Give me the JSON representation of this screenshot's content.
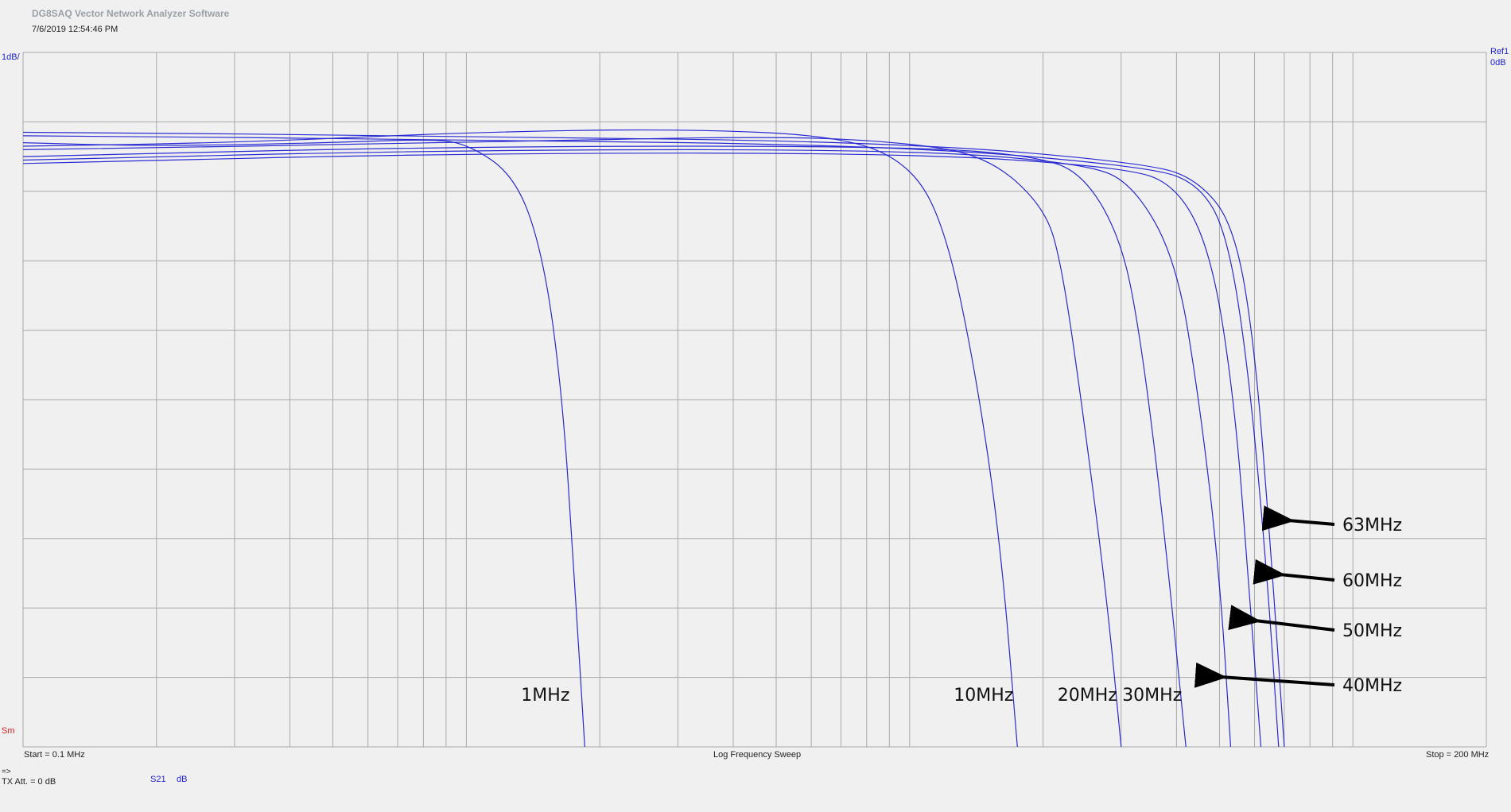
{
  "app": {
    "title": "DG8SAQ Vector Network Analyzer Software",
    "datetime": "7/6/2019    12:54:46 PM"
  },
  "plot": {
    "scale_label": "1dB/",
    "ref_label": "Ref1",
    "ref_value": "0dB",
    "marker_label": "Sm",
    "start_label": "Start = 0.1 MHz",
    "sweep_label": "Log Frequency Sweep",
    "stop_label": "Stop = 200 MHz"
  },
  "footer": {
    "arrow": "=>",
    "tx_att": "TX Att.  = 0 dB",
    "trace_param": "S21",
    "trace_unit": "dB"
  },
  "colors": {
    "trace": "#2a2ad4",
    "grid": "#a9a9a9",
    "background": "#f0f0f0",
    "arrow": "#000000"
  },
  "chart_data": {
    "type": "line",
    "x_scale": "log",
    "xlim": [
      0.1,
      200
    ],
    "ylim": [
      -9,
      1
    ],
    "x_unit": "MHz",
    "y_unit": "dB",
    "grid": true,
    "series": [
      {
        "name": "1MHz",
        "points": [
          [
            0.1,
            -0.3
          ],
          [
            0.2,
            -0.35
          ],
          [
            0.5,
            -0.3
          ],
          [
            0.8,
            -0.25
          ],
          [
            1.0,
            -0.3
          ],
          [
            1.3,
            -0.8
          ],
          [
            1.5,
            -2.0
          ],
          [
            1.65,
            -4.0
          ],
          [
            1.75,
            -6.5
          ],
          [
            1.85,
            -9.0
          ]
        ]
      },
      {
        "name": "10MHz",
        "points": [
          [
            0.1,
            -0.35
          ],
          [
            0.3,
            -0.3
          ],
          [
            1,
            -0.15
          ],
          [
            3,
            -0.1
          ],
          [
            7,
            -0.2
          ],
          [
            10,
            -0.6
          ],
          [
            12,
            -1.5
          ],
          [
            14,
            -3.5
          ],
          [
            16,
            -6.0
          ],
          [
            17.5,
            -9.0
          ]
        ]
      },
      {
        "name": "20MHz",
        "points": [
          [
            0.1,
            -0.4
          ],
          [
            1,
            -0.3
          ],
          [
            5,
            -0.2
          ],
          [
            10,
            -0.3
          ],
          [
            15,
            -0.5
          ],
          [
            20,
            -1.2
          ],
          [
            22,
            -2.0
          ],
          [
            25,
            -4.5
          ],
          [
            28,
            -7.0
          ],
          [
            30,
            -9.0
          ]
        ]
      },
      {
        "name": "30MHz",
        "points": [
          [
            0.1,
            -0.5
          ],
          [
            1,
            -0.35
          ],
          [
            10,
            -0.35
          ],
          [
            20,
            -0.5
          ],
          [
            25,
            -0.8
          ],
          [
            30,
            -1.7
          ],
          [
            33,
            -3.0
          ],
          [
            37,
            -5.5
          ],
          [
            42,
            -9.0
          ]
        ]
      },
      {
        "name": "40MHz",
        "points": [
          [
            0.1,
            -0.55
          ],
          [
            1,
            -0.4
          ],
          [
            10,
            -0.4
          ],
          [
            25,
            -0.6
          ],
          [
            32,
            -0.9
          ],
          [
            40,
            -2.0
          ],
          [
            45,
            -4.0
          ],
          [
            50,
            -6.5
          ],
          [
            53,
            -9.0
          ]
        ]
      },
      {
        "name": "50MHz",
        "points": [
          [
            0.1,
            -0.6
          ],
          [
            1,
            -0.45
          ],
          [
            10,
            -0.45
          ],
          [
            30,
            -0.65
          ],
          [
            40,
            -0.9
          ],
          [
            48,
            -1.9
          ],
          [
            54,
            -4.0
          ],
          [
            58,
            -6.5
          ],
          [
            62,
            -9.0
          ]
        ]
      },
      {
        "name": "60MHz",
        "points": [
          [
            0.1,
            -0.2
          ],
          [
            1,
            -0.25
          ],
          [
            10,
            -0.35
          ],
          [
            35,
            -0.65
          ],
          [
            45,
            -0.9
          ],
          [
            52,
            -1.6
          ],
          [
            58,
            -3.5
          ],
          [
            64,
            -6.5
          ],
          [
            68,
            -9.0
          ]
        ]
      },
      {
        "name": "63MHz",
        "points": [
          [
            0.1,
            -0.15
          ],
          [
            1,
            -0.2
          ],
          [
            10,
            -0.3
          ],
          [
            35,
            -0.6
          ],
          [
            45,
            -0.85
          ],
          [
            54,
            -1.5
          ],
          [
            60,
            -3.2
          ],
          [
            65,
            -6.0
          ],
          [
            70,
            -9.0
          ]
        ]
      }
    ],
    "annotations": [
      {
        "text": "1MHz",
        "style": "label"
      },
      {
        "text": "10MHz",
        "style": "label"
      },
      {
        "text": "20MHz",
        "style": "label"
      },
      {
        "text": "30MHz",
        "style": "label"
      },
      {
        "text": "40MHz",
        "style": "arrow"
      },
      {
        "text": "50MHz",
        "style": "arrow"
      },
      {
        "text": "60MHz",
        "style": "arrow"
      },
      {
        "text": "63MHz",
        "style": "arrow"
      }
    ]
  }
}
